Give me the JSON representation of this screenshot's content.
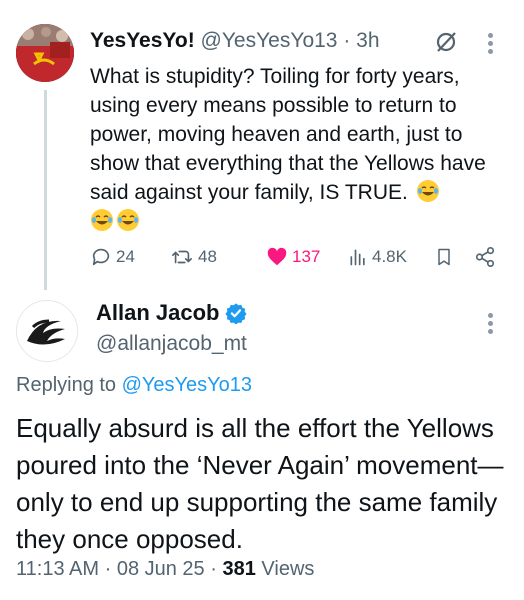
{
  "parent_tweet": {
    "display_name": "YesYesYo!",
    "handle": "@YesYesYo13",
    "separator": "·",
    "time": "3h",
    "text": "What is stupidity? Toiling for forty years, using every means possible to return to power, moving heaven and earth, just to show that everything that the Yellows have said against your family, IS TRUE.",
    "emojis": [
      "joy-emoji",
      "joy-emoji",
      "joy-emoji"
    ],
    "metrics": {
      "replies": "24",
      "reposts": "48",
      "likes": "137",
      "views": "4.8K"
    },
    "colors": {
      "like": "#f91880",
      "secondary_text": "#536471",
      "thread_line": "#cfd9de"
    }
  },
  "reply_tweet": {
    "display_name": "Allan Jacob",
    "handle": "@allanjacob_mt",
    "replying_prefix": "Replying to",
    "replying_to": "@YesYesYo13",
    "text": "Equally absurd is all the effort the Yellows poured into the ‘Never Again’ movement—only to end up supporting the same family they once opposed.",
    "time": "11:13 AM",
    "separator": "·",
    "date": "08 Jun 25",
    "views_count": "381",
    "views_label": "Views",
    "colors": {
      "verified": "#1d9bf0",
      "mention": "#1d9bf0"
    }
  }
}
